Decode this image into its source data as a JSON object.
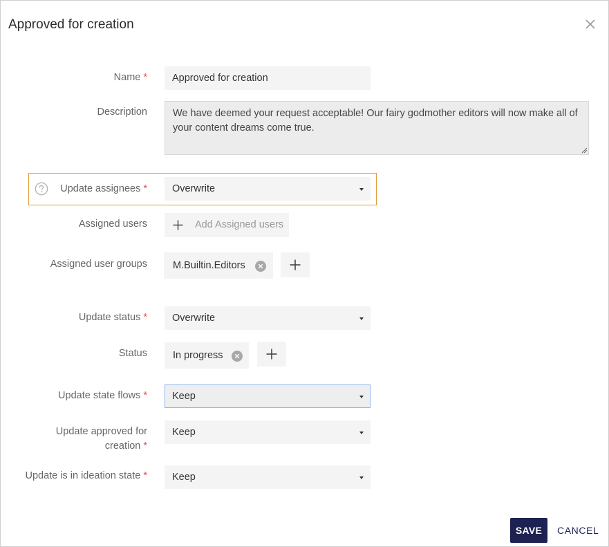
{
  "dialog": {
    "title": "Approved for creation",
    "close_icon": "close-icon"
  },
  "fields": {
    "name": {
      "label": "Name",
      "required": "*",
      "value": "Approved for creation"
    },
    "description": {
      "label": "Description",
      "value": "We have deemed your request acceptable! Our fairy godmother editors will now make all of your content dreams come true."
    },
    "update_assignees": {
      "label": "Update assignees",
      "required": "*",
      "value": "Overwrite",
      "help_icon": "help-icon"
    },
    "assigned_users": {
      "label": "Assigned users",
      "add_label": "Add Assigned users"
    },
    "assigned_user_groups": {
      "label": "Assigned user groups",
      "chips": [
        "M.Builtin.Editors"
      ]
    },
    "update_status": {
      "label": "Update status",
      "required": "*",
      "value": "Overwrite"
    },
    "status": {
      "label": "Status",
      "chips": [
        "In progress"
      ]
    },
    "update_state_flows": {
      "label": "Update state flows",
      "required": "*",
      "value": "Keep"
    },
    "update_approved_for_creation": {
      "label_line1": "Update approved for",
      "label_line2": "creation",
      "required": "*",
      "value": "Keep"
    },
    "update_is_in_ideation_state": {
      "label": "Update is in ideation state",
      "required": "*",
      "value": "Keep"
    }
  },
  "footer": {
    "save_label": "SAVE",
    "cancel_label": "CANCEL"
  },
  "colors": {
    "accent": "#1d2252",
    "required": "#d9534f",
    "highlight_border": "#e09a35",
    "focus_border": "#8fb4ee"
  }
}
